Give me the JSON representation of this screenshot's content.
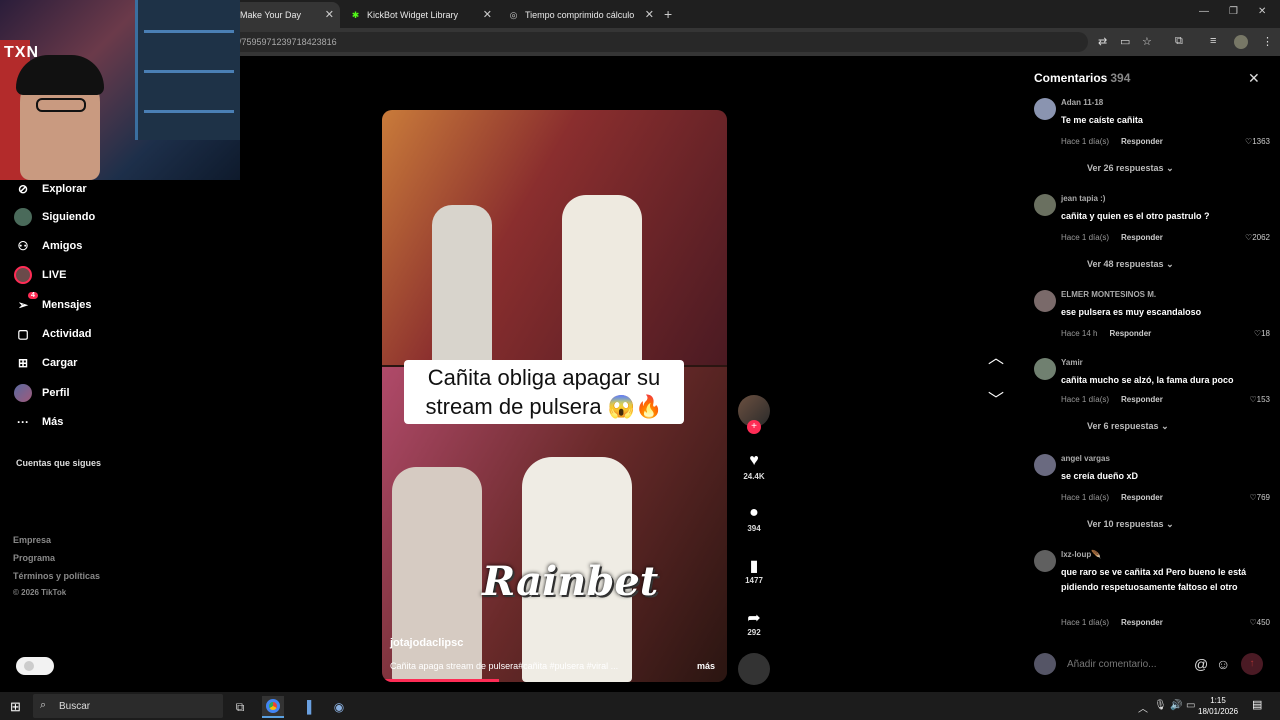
{
  "browser": {
    "tabs": [
      {
        "label": "Make Your Day",
        "active": true
      },
      {
        "label": "KickBot Widget Library",
        "active": false
      },
      {
        "label": "Tiempo comprimido cálculo",
        "active": false
      }
    ],
    "url": "o/7595971239718423816"
  },
  "webcam": {
    "logo": "TXN"
  },
  "sidebar": {
    "items": [
      {
        "label": "Explorar",
        "icon": "compass-icon"
      },
      {
        "label": "Siguiendo",
        "icon": "following-avatar"
      },
      {
        "label": "Amigos",
        "icon": "friends-icon"
      },
      {
        "label": "LIVE",
        "icon": "live-avatar"
      },
      {
        "label": "Mensajes",
        "icon": "messages-icon",
        "badge": "4"
      },
      {
        "label": "Actividad",
        "icon": "activity-icon"
      },
      {
        "label": "Cargar",
        "icon": "upload-icon"
      },
      {
        "label": "Perfil",
        "icon": "profile-avatar"
      },
      {
        "label": "Más",
        "icon": "more-icon"
      }
    ],
    "following_heading": "Cuentas que sigues",
    "footer": {
      "links": [
        "Empresa",
        "Programa",
        "Términos y políticas"
      ],
      "copyright": "© 2026 TikTok"
    }
  },
  "video": {
    "caption": "Cañita obliga apagar su stream de pulsera 😱🔥",
    "watermark": "Rainbet",
    "username": "jotajodaclipsc",
    "description": "Cañita apaga stream de pulsera#cañita #pulsera #viral ...",
    "more_label": "más",
    "progress": 0.34
  },
  "actions": {
    "likes": "24.4K",
    "comments": "394",
    "saves": "1477",
    "shares": "292"
  },
  "comments": {
    "title": "Comentarios",
    "count": "394",
    "reply_label": "Responder",
    "items": [
      {
        "user": "Adan 11-18",
        "text": "Te me caíste cañita",
        "time": "Hace 1 día(s)",
        "likes": "1363",
        "more": "Ver 26 respuestas"
      },
      {
        "user": "jean tapia :)",
        "text": "cañita y quien es el otro pastrulo ?",
        "time": "Hace 1 día(s)",
        "likes": "2062",
        "more": "Ver 48 respuestas"
      },
      {
        "user": "ELMER MONTESINOS M.",
        "text": "ese pulsera es muy escandaloso",
        "time": "Hace 14 h",
        "likes": "18",
        "more": ""
      },
      {
        "user": "Yamir",
        "text": "cañita mucho se alzó, la fama dura poco",
        "time": "Hace 1 día(s)",
        "likes": "153",
        "more": "Ver 6 respuestas"
      },
      {
        "user": "angel vargas",
        "text": "se creía dueño xD",
        "time": "Hace 1 día(s)",
        "likes": "769",
        "more": "Ver 10 respuestas"
      },
      {
        "user": "lxz-loup🪶",
        "text": "que raro se ve cañita xd Pero bueno le está pidiendo respetuosamente faltoso el otro",
        "time": "Hace 1 día(s)",
        "likes": "450",
        "more": ""
      }
    ],
    "input_placeholder": "Añadir comentario..."
  },
  "taskbar": {
    "search_placeholder": "Buscar",
    "time": "1:15",
    "date": "18/01/2026",
    "notifications": "2"
  }
}
